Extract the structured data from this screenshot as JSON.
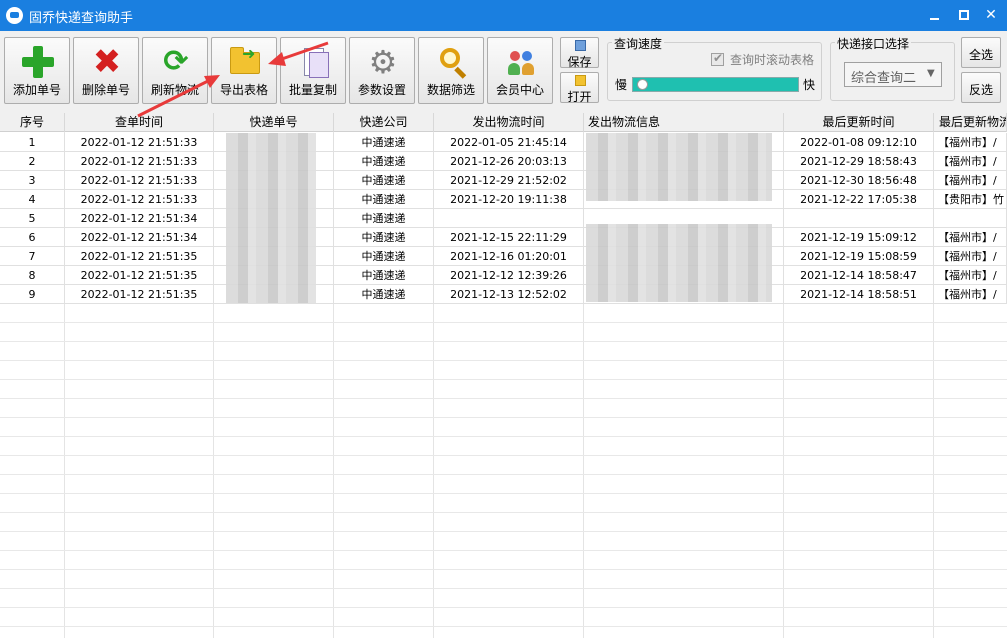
{
  "window": {
    "title": "固乔快递查询助手"
  },
  "toolbar": {
    "add": "添加单号",
    "delete": "删除单号",
    "refresh": "刷新物流",
    "export": "导出表格",
    "batch_copy": "批量复制",
    "settings": "参数设置",
    "filter": "数据筛选",
    "member": "会员中心",
    "save": "保存",
    "open": "打开",
    "select_all": "全选",
    "invert": "反选"
  },
  "speed": {
    "title": "查询速度",
    "scroll_checkbox": "查询时滚动表格",
    "slow": "慢",
    "fast": "快"
  },
  "api": {
    "title": "快递接口选择",
    "selected": "综合查询二"
  },
  "table": {
    "headers": [
      "序号",
      "查单时间",
      "快递单号",
      "快递公司",
      "发出物流时间",
      "发出物流信息",
      "最后更新时间",
      "最后更新物流"
    ],
    "rows": [
      {
        "no": "1",
        "query_time": "2022-01-12 21:51:33",
        "company": "中通速递",
        "send_time": "2022-01-05 21:45:14",
        "update_time": "2022-01-08 09:12:10",
        "update_info": "【福州市】/"
      },
      {
        "no": "2",
        "query_time": "2022-01-12 21:51:33",
        "company": "中通速递",
        "send_time": "2021-12-26 20:03:13",
        "update_time": "2021-12-29 18:58:43",
        "update_info": "【福州市】/"
      },
      {
        "no": "3",
        "query_time": "2022-01-12 21:51:33",
        "company": "中通速递",
        "send_time": "2021-12-29 21:52:02",
        "update_time": "2021-12-30 18:56:48",
        "update_info": "【福州市】/"
      },
      {
        "no": "4",
        "query_time": "2022-01-12 21:51:33",
        "company": "中通速递",
        "send_time": "2021-12-20 19:11:38",
        "update_time": "2021-12-22 17:05:38",
        "update_info": "【贵阳市】竹"
      },
      {
        "no": "5",
        "query_time": "2022-01-12 21:51:34",
        "company": "中通速递",
        "send_time": "",
        "update_time": "",
        "update_info": ""
      },
      {
        "no": "6",
        "query_time": "2022-01-12 21:51:34",
        "company": "中通速递",
        "send_time": "2021-12-15 22:11:29",
        "update_time": "2021-12-19 15:09:12",
        "update_info": "【福州市】/"
      },
      {
        "no": "7",
        "query_time": "2022-01-12 21:51:35",
        "company": "中通速递",
        "send_time": "2021-12-16 01:20:01",
        "update_time": "2021-12-19 15:08:59",
        "update_info": "【福州市】/"
      },
      {
        "no": "8",
        "query_time": "2022-01-12 21:51:35",
        "company": "中通速递",
        "send_time": "2021-12-12 12:39:26",
        "update_time": "2021-12-14 18:58:47",
        "update_info": "【福州市】/"
      },
      {
        "no": "9",
        "query_time": "2022-01-12 21:51:35",
        "company": "中通速递",
        "send_time": "2021-12-13 12:52:02",
        "update_time": "2021-12-14 18:58:51",
        "update_info": "【福州市】/"
      }
    ]
  },
  "annotation_color": "#e83a3a"
}
